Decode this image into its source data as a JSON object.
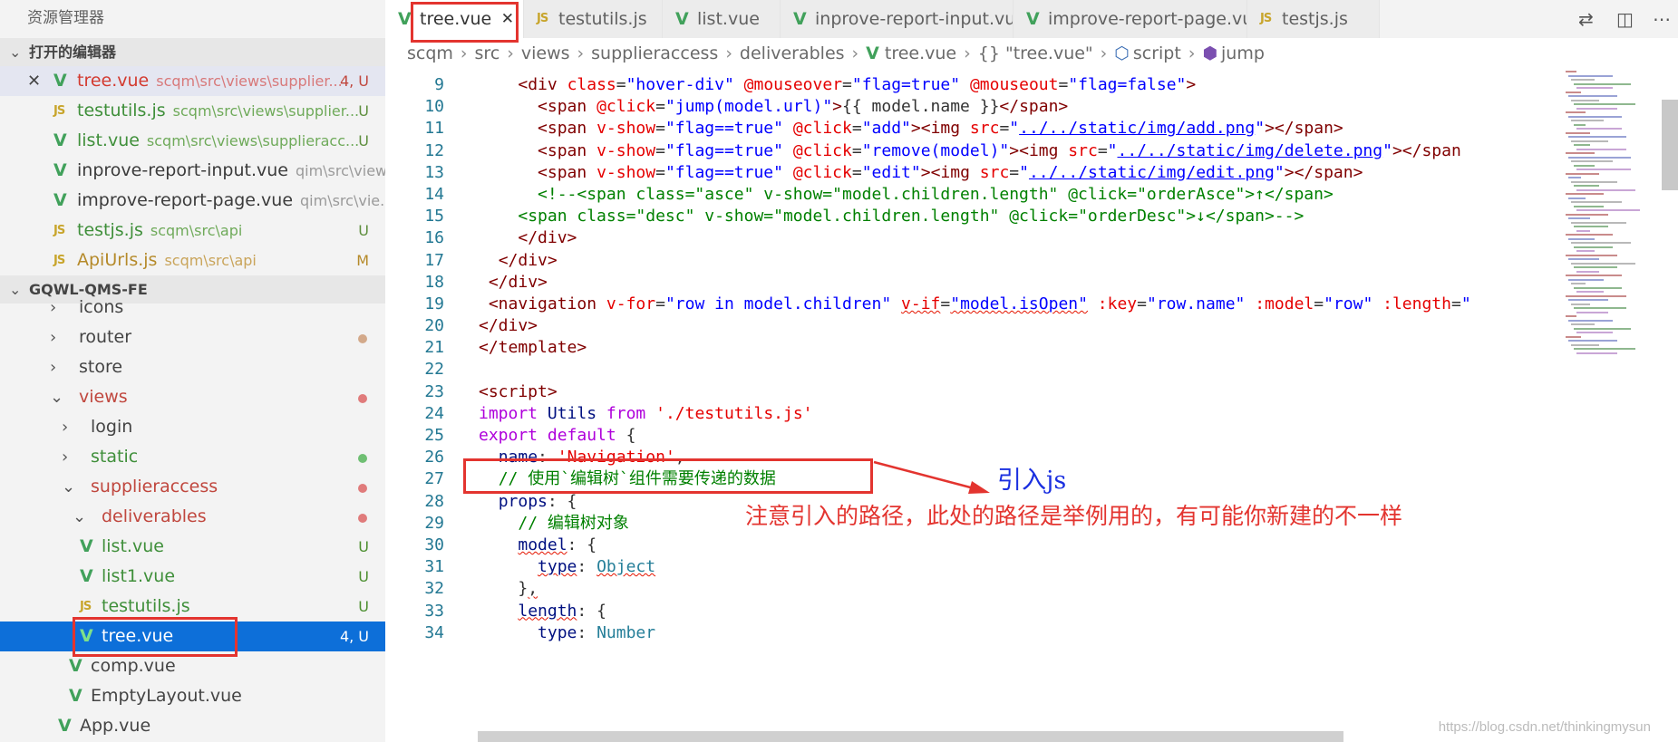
{
  "sidebar": {
    "title": "资源管理器",
    "open_editors": {
      "header": "打开的编辑器",
      "items": [
        {
          "name": "tree.vue",
          "path": "scqm\\src\\views\\supplier...",
          "badge": "4, U",
          "icon": "vue-icon",
          "active": true
        },
        {
          "name": "testutils.js",
          "path": "scqm\\src\\views\\supplier...",
          "badge": "U",
          "icon": "js-icon"
        },
        {
          "name": "list.vue",
          "path": "scqm\\src\\views\\supplieracc...",
          "badge": "U",
          "icon": "vue-icon"
        },
        {
          "name": "inprove-report-input.vue",
          "path": "qim\\src\\view...",
          "badge": "",
          "icon": "vue-icon"
        },
        {
          "name": "improve-report-page.vue",
          "path": "qim\\src\\vie...",
          "badge": "",
          "icon": "vue-icon"
        },
        {
          "name": "testjs.js",
          "path": "scqm\\src\\api",
          "badge": "U",
          "icon": "js-icon"
        },
        {
          "name": "ApiUrls.js",
          "path": "scqm\\src\\api",
          "badge": "M",
          "icon": "js-icon"
        }
      ]
    },
    "project": {
      "header": "GQWL-QMS-FE",
      "items": [
        {
          "name": "icons",
          "type": "folder",
          "indent": 0
        },
        {
          "name": "router",
          "type": "folder",
          "indent": 0,
          "dot": "#d3a98a"
        },
        {
          "name": "store",
          "type": "folder",
          "indent": 0
        },
        {
          "name": "views",
          "type": "folder-open",
          "indent": 0,
          "dot": "#e07b7b",
          "color": "#c0473e"
        },
        {
          "name": "login",
          "type": "folder",
          "indent": 1
        },
        {
          "name": "static",
          "type": "folder",
          "indent": 1,
          "dot": "#6fbf73",
          "color": "#3f8f3a"
        },
        {
          "name": "supplieraccess",
          "type": "folder-open",
          "indent": 1,
          "dot": "#e07b7b",
          "color": "#c0473e"
        },
        {
          "name": "deliverables",
          "type": "folder-open",
          "indent": 2,
          "dot": "#e07b7b",
          "color": "#c0473e"
        },
        {
          "name": "list.vue",
          "type": "vue",
          "indent": 3,
          "badge": "U",
          "color": "#3f8f3a"
        },
        {
          "name": "list1.vue",
          "type": "vue",
          "indent": 3,
          "badge": "U",
          "color": "#3f8f3a"
        },
        {
          "name": "testutils.js",
          "type": "js",
          "indent": 3,
          "badge": "U",
          "color": "#3f8f3a"
        },
        {
          "name": "tree.vue",
          "type": "vue",
          "indent": 3,
          "badge": "4, U",
          "selected": true
        },
        {
          "name": "comp.vue",
          "type": "vue",
          "indent": 2
        },
        {
          "name": "EmptyLayout.vue",
          "type": "vue",
          "indent": 2
        },
        {
          "name": "App.vue",
          "type": "vue",
          "indent": 1
        }
      ]
    }
  },
  "tabs": [
    {
      "label": "tree.vue",
      "icon": "vue-icon",
      "active": true
    },
    {
      "label": "testutils.js",
      "icon": "js-icon"
    },
    {
      "label": "list.vue",
      "icon": "vue-icon"
    },
    {
      "label": "inprove-report-input.vue",
      "icon": "vue-icon"
    },
    {
      "label": "improve-report-page.vue",
      "icon": "vue-icon"
    },
    {
      "label": "testjs.js",
      "icon": "js-icon"
    }
  ],
  "breadcrumb": {
    "parts": [
      "scqm",
      "src",
      "views",
      "supplieraccess",
      "deliverables"
    ],
    "file": "tree.vue",
    "scope1": "{} \"tree.vue\"",
    "scope2": "script",
    "scope3": "jump"
  },
  "code_lines": [
    {
      "n": "9"
    },
    {
      "n": "10"
    },
    {
      "n": "11"
    },
    {
      "n": "12"
    },
    {
      "n": "13"
    },
    {
      "n": "14"
    },
    {
      "n": "15"
    },
    {
      "n": "16"
    },
    {
      "n": "17"
    },
    {
      "n": "18"
    },
    {
      "n": "19"
    },
    {
      "n": "20"
    },
    {
      "n": "21"
    },
    {
      "n": "22"
    },
    {
      "n": "23"
    },
    {
      "n": "24"
    },
    {
      "n": "25"
    },
    {
      "n": "26"
    },
    {
      "n": "27"
    },
    {
      "n": "28"
    },
    {
      "n": "29"
    },
    {
      "n": "30"
    },
    {
      "n": "31"
    },
    {
      "n": "32"
    },
    {
      "n": "33"
    },
    {
      "n": "34"
    }
  ],
  "annotations": {
    "import_note": "引入js",
    "path_note": "注意引入的路径，此处的路径是举例用的，有可能你新建的不一样"
  },
  "watermark": "https://blog.csdn.net/thinkingmysun",
  "colors": {
    "accent_red": "#e3342f",
    "selection_blue": "#0d6fd9",
    "annotation_blue": "#1a2fe0"
  }
}
